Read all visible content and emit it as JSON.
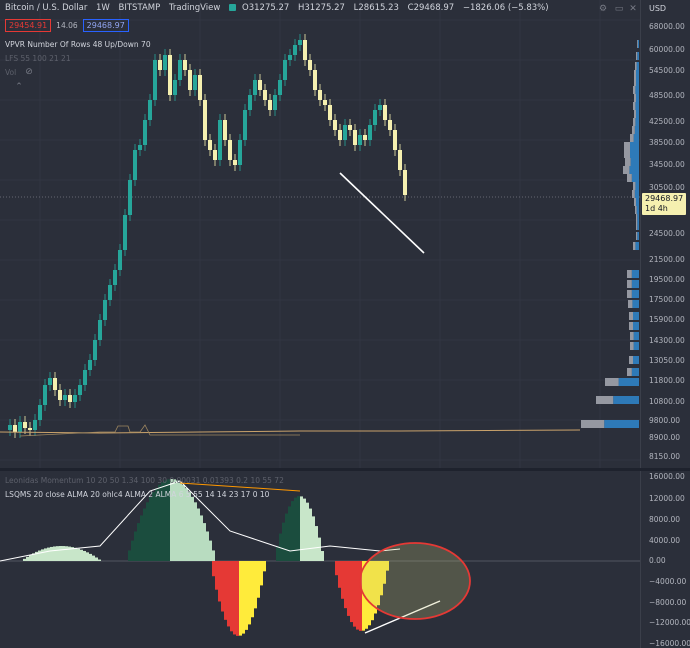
{
  "header": {
    "symbol": "Bitcoin / U.S. Dollar",
    "interval": "1W",
    "exchange": "BITSTAMP",
    "source": "TradingView",
    "open": "O31275.27",
    "high": "H31275.27",
    "low": "L28615.23",
    "close": "C29468.97",
    "change": "−1826.06 (−5.83%)"
  },
  "trade": {
    "sell": "29454.91",
    "spread": "14.06",
    "buy": "29468.97"
  },
  "indicators": {
    "vpvr": "VPVR Number Of Rows 48 Up/Down 70",
    "lfs": "LFS 55 100 21 21",
    "vol": "Vol",
    "momentum": "Leonidas Momentum 10 20 50 1.34 100 30 0.00031 0.01393 0.2 10 55 72",
    "lsqms": "LSQMS 20 close ALMA 20 ohlc4 ALMA 2 ALMA 6 5 55 14 14 23 17 0 10"
  },
  "axis_main": {
    "currency": "USD",
    "ticks": [
      "68000.00",
      "60000.00",
      "54500.00",
      "48500.00",
      "42500.00",
      "38500.00",
      "34500.00",
      "30500.00",
      "24500.00",
      "21500.00",
      "19500.00",
      "17500.00",
      "15900.00",
      "14300.00",
      "13050.00",
      "11800.00",
      "10800.00",
      "9800.00",
      "8900.00",
      "8150.00"
    ]
  },
  "axis_sub": {
    "ticks": [
      "16000.00",
      "12000.00",
      "8000.00",
      "4000.00",
      "0.00",
      "−4000.00",
      "−8000.00",
      "−12000.00",
      "−16000.00"
    ]
  },
  "price_tag": {
    "price": "29468.97",
    "countdown": "1d 4h"
  },
  "colors": {
    "up": "#26a69a",
    "down": "#f5f0b0",
    "profile_up": "#2e7ab8",
    "profile_down": "#b2b5be",
    "accent_red": "#e53935",
    "orange": "#ff9800"
  },
  "icons": [
    "settings-icon",
    "maximize-icon",
    "close-icon",
    "eye-icon",
    "collapse-icon"
  ]
}
